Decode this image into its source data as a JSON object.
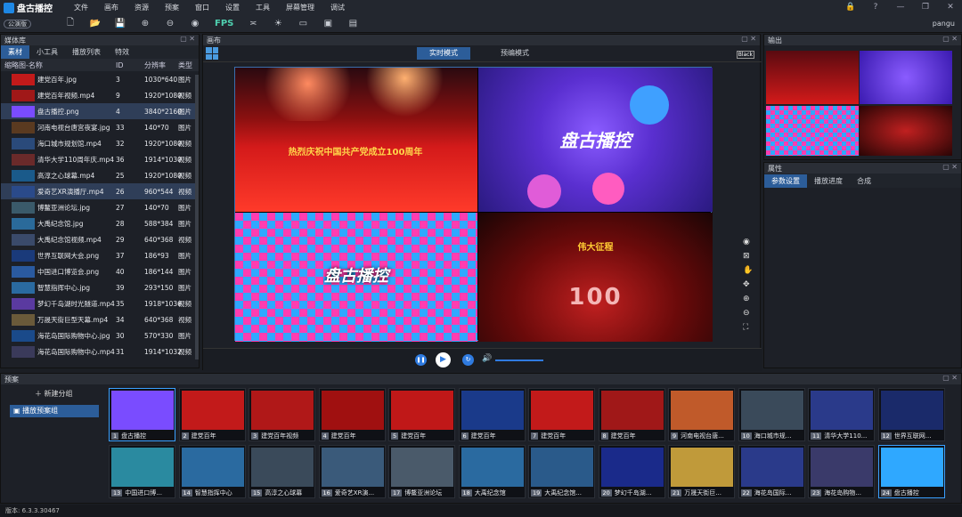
{
  "app": {
    "name": "盘古播控",
    "publish": "公演版",
    "user": "pangu",
    "version": "版本: 6.3.3.30467"
  },
  "menu": [
    "文件",
    "画布",
    "资源",
    "预案",
    "窗口",
    "设置",
    "工具",
    "屏幕管理",
    "调试"
  ],
  "toolbar": {
    "fps": "FPS"
  },
  "media": {
    "title": "媒体库",
    "tabs": [
      "素材",
      "小工具",
      "播放列表",
      "特效"
    ],
    "columns": [
      "缩略图-名称",
      "ID",
      "分辨率",
      "类型"
    ],
    "rows": [
      [
        "建党百年.jpg",
        "3",
        "1030*640",
        "图片"
      ],
      [
        "建党百年视频.mp4",
        "9",
        "1920*1080",
        "视频"
      ],
      [
        "盘古播控.png",
        "4",
        "3840*2160",
        "图片"
      ],
      [
        "河南电视台唐宫夜宴.jpg",
        "33",
        "140*70",
        "图片"
      ],
      [
        "海口城市规划馆.mp4",
        "32",
        "1920*1080",
        "视频"
      ],
      [
        "清华大学110周年庆.mp4",
        "36",
        "1914*1030",
        "视频"
      ],
      [
        "高淳之心球幕.mp4",
        "25",
        "1920*1080",
        "视频"
      ],
      [
        "爱奇艺XR演播厅.mp4",
        "26",
        "960*544",
        "视频"
      ],
      [
        "博鳌亚洲论坛.jpg",
        "27",
        "140*70",
        "图片"
      ],
      [
        "大禹纪念馆.jpg",
        "28",
        "588*384",
        "图片"
      ],
      [
        "大禹纪念馆视频.mp4",
        "29",
        "640*368",
        "视频"
      ],
      [
        "世界互联网大会.png",
        "37",
        "186*93",
        "图片"
      ],
      [
        "中国进口博览会.png",
        "40",
        "186*144",
        "图片"
      ],
      [
        "智慧指挥中心.jpg",
        "39",
        "293*150",
        "图片"
      ],
      [
        "梦幻千岛湖时光隧道.mp4",
        "35",
        "1918*1036",
        "视频"
      ],
      [
        "万晟天街巨型天幕.mp4",
        "34",
        "640*368",
        "视频"
      ],
      [
        "海花岛国际购物中心.jpg",
        "30",
        "570*330",
        "图片"
      ],
      [
        "海花岛国际购物中心.mp4",
        "31",
        "1914*1032",
        "视频"
      ]
    ]
  },
  "canvas": {
    "title": "画布",
    "modes": [
      "实时模式",
      "预编模式"
    ],
    "black": "Black",
    "banner": "热烈庆祝中国共产党成立100周年",
    "logo": "盘古播控",
    "logo2": "盘古播控",
    "stage": "伟大征程",
    "hundred": "100"
  },
  "output": {
    "title": "输出"
  },
  "props": {
    "title": "属性",
    "tabs": [
      "参数设置",
      "播放进度",
      "合成"
    ]
  },
  "presets": {
    "title": "预案",
    "new_group": "新建分组",
    "group": "播放预案组",
    "tiles": [
      [
        "1",
        "盘古播控"
      ],
      [
        "2",
        "建党百年"
      ],
      [
        "3",
        "建党百年视频"
      ],
      [
        "4",
        "建党百年"
      ],
      [
        "5",
        "建党百年"
      ],
      [
        "6",
        "建党百年"
      ],
      [
        "7",
        "建党百年"
      ],
      [
        "8",
        "建党百年"
      ],
      [
        "9",
        "河南电视台唐..."
      ],
      [
        "10",
        "海口城市规..."
      ],
      [
        "11",
        "清华大学110..."
      ],
      [
        "12",
        "世界互联网..."
      ],
      [
        "13",
        "中国进口博..."
      ],
      [
        "14",
        "智慧指挥中心"
      ],
      [
        "15",
        "高淳之心球幕"
      ],
      [
        "16",
        "爱奇艺XR演..."
      ],
      [
        "17",
        "博鳌亚洲论坛"
      ],
      [
        "18",
        "大禹纪念馆"
      ],
      [
        "19",
        "大禹纪念馆..."
      ],
      [
        "20",
        "梦幻千岛湖..."
      ],
      [
        "21",
        "万晟天街巨..."
      ],
      [
        "22",
        "海花岛国际..."
      ],
      [
        "23",
        "海花岛购物..."
      ],
      [
        "24",
        "盘古播控"
      ]
    ]
  },
  "colors": {
    "accent": "#2c5d99",
    "selected": "#3aa0ff"
  }
}
